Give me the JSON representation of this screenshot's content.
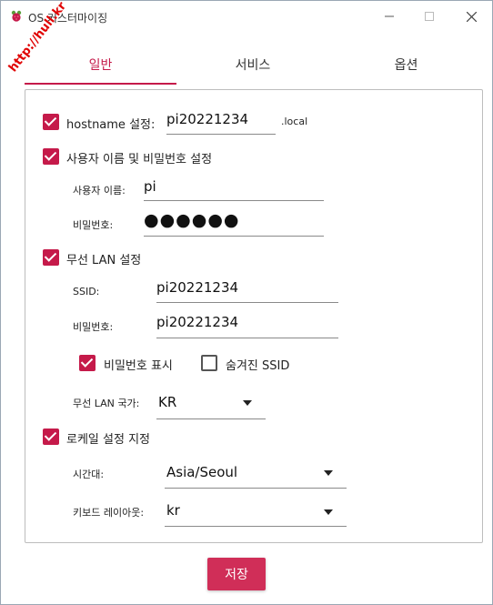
{
  "window": {
    "title": "OS 커스터마이징",
    "watermark": "http://hull.kr"
  },
  "tabs": [
    {
      "label": "일반",
      "active": true
    },
    {
      "label": "서비스",
      "active": false
    },
    {
      "label": "옵션",
      "active": false
    }
  ],
  "general": {
    "hostname": {
      "checked": true,
      "label": "hostname 설정:",
      "value": "pi20221234",
      "suffix": ".local"
    },
    "user": {
      "checked": true,
      "label": "사용자 이름 및 비밀번호 설정",
      "username_label": "사용자 이름:",
      "username_value": "pi",
      "password_label": "비밀번호:",
      "password_mask": "●●●●●●"
    },
    "wifi": {
      "checked": true,
      "label": "무선 LAN 설정",
      "ssid_label": "SSID:",
      "ssid_value": "pi20221234",
      "password_label": "비밀번호:",
      "password_value": "pi20221234",
      "show_password": {
        "checked": true,
        "label": "비밀번호 표시"
      },
      "hidden_ssid": {
        "checked": false,
        "label": "숨겨진 SSID"
      },
      "country_label": "무선 LAN 국가:",
      "country_value": "KR"
    },
    "locale": {
      "checked": true,
      "label": "로케일 설정 지정",
      "timezone_label": "시간대:",
      "timezone_value": "Asia/Seoul",
      "keyboard_label": "키보드 레이아웃:",
      "keyboard_value": "kr"
    }
  },
  "actions": {
    "save_label": "저장"
  },
  "colors": {
    "accent": "#c51a4a",
    "button": "#d02e58"
  }
}
